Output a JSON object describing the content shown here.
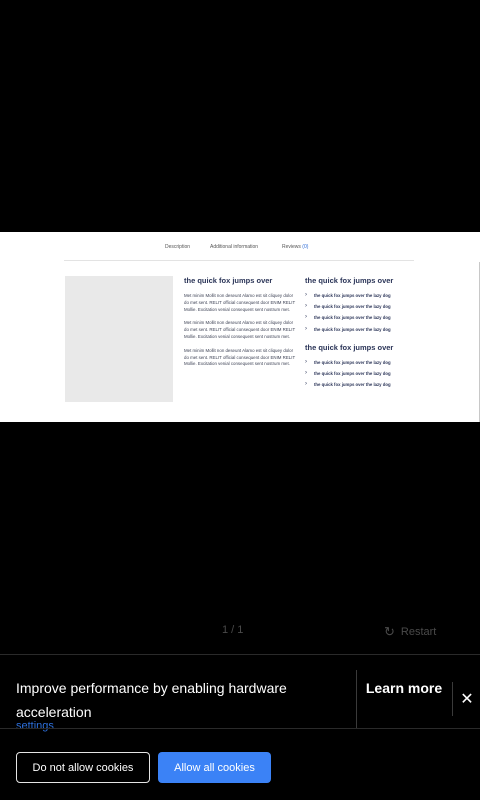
{
  "preview": {
    "tabs": {
      "description": "Description",
      "additional": "Additional information",
      "reviews": "Reviews",
      "reviews_count": "(0)"
    },
    "middle": {
      "heading": "the quick fox jumps over",
      "paragraphs": [
        "Met minim Mollit non deseunt Alamo est sit cliquey dolor do met sent. RELIT official consequent door ENIM RELIT Mollie. Excitation venial consequent sent nostrum met.",
        "Met minim Mollit non deseunt Alamo est sit cliquey dolor do met sent. RELIT official consequent door ENIM RELIT Mollie. Excitation venial consequent sent nostrum met.",
        "Met minim Mollit non deseunt Alamo est sit cliquey dolor do met sent. RELIT official consequent door ENIM RELIT Mollie. Excitation venial consequent sent nostrum met."
      ]
    },
    "right": {
      "heading1": "the quick fox jumps over",
      "list1": [
        "the quick fox jumps over the lazy dog",
        "the quick fox jumps over the lazy dog",
        "the quick fox jumps over the lazy dog",
        "the quick fox jumps over the lazy dog"
      ],
      "heading2": "the quick fox jumps over",
      "list2": [
        "the quick fox jumps over the lazy dog",
        "the quick fox jumps over the lazy dog",
        "the quick fox jumps over the lazy dog"
      ]
    }
  },
  "viewer": {
    "pager": "1 / 1",
    "restart_label": "Restart"
  },
  "cookie": {
    "message": "Improve performance by enabling hardware acceleration",
    "settings_link": "settings",
    "learn_more": "Learn more",
    "close_glyph": "✕",
    "deny_label": "Do not allow cookies",
    "allow_label": "Allow all cookies",
    "allow_color": "#3b82f6"
  },
  "icons": {
    "restart": "↻",
    "chevron": "›"
  }
}
